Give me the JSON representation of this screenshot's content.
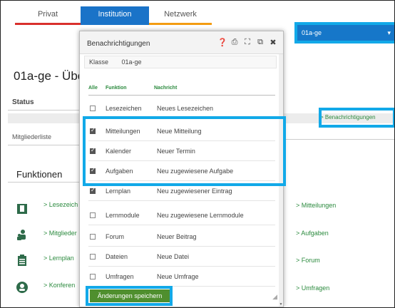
{
  "tabs": [
    "Privat",
    "Institution",
    "Netzwerk"
  ],
  "select": {
    "value": "01a-ge",
    "chevron": "chevron-down-icon"
  },
  "page": {
    "title": "01a-ge - Übe",
    "status_label": "Status",
    "notif_link": "> Benachrichtigungen",
    "members_label": "Mitgliederliste",
    "functions_title": "Funktionen",
    "left_functions": [
      "> Lesezeich",
      "> Mitglieder",
      "> Lernplan",
      "> Konferen"
    ],
    "right_functions": [
      "> Mitteilungen",
      "> Aufgaben",
      "> Forum",
      "> Umfragen"
    ]
  },
  "modal": {
    "title": "Benachrichtigungen",
    "icons": [
      "help-icon",
      "print-icon",
      "expand-icon",
      "pin-icon",
      "close-icon"
    ],
    "klasse_label": "Klasse",
    "klasse_value": "01a-ge",
    "col_alle": "Alle",
    "col_funktion": "Funktion",
    "col_nachricht": "Nachricht",
    "rows": [
      {
        "fn": "Lesezeichen",
        "msg": "Neues Lesezeichen",
        "checked": false
      },
      {
        "fn": "Mitteilungen",
        "msg": "Neue Mitteilung",
        "checked": true
      },
      {
        "fn": "Kalender",
        "msg": "Neuer Termin",
        "checked": true
      },
      {
        "fn": "Aufgaben",
        "msg": "Neu zugewiesene Aufgabe",
        "checked": true
      },
      {
        "fn": "Lernplan",
        "msg": "Neu zugewiesener Eintrag",
        "checked": true
      },
      {
        "fn": "Lernmodule",
        "msg": "Neu zugewiesene Lernmodule",
        "checked": false
      },
      {
        "fn": "Forum",
        "msg": "Neuer Beitrag",
        "checked": false
      },
      {
        "fn": "Dateien",
        "msg": "Neue Datei",
        "checked": false
      },
      {
        "fn": "Umfragen",
        "msg": "Neue Umfrage",
        "checked": false
      }
    ],
    "save_label": "Änderungen speichern"
  },
  "colors": {
    "tab_active": "#1a73c8",
    "highlight": "#12a9e8",
    "save_button": "#4f8f2e",
    "link_green": "#2b8a3e"
  }
}
